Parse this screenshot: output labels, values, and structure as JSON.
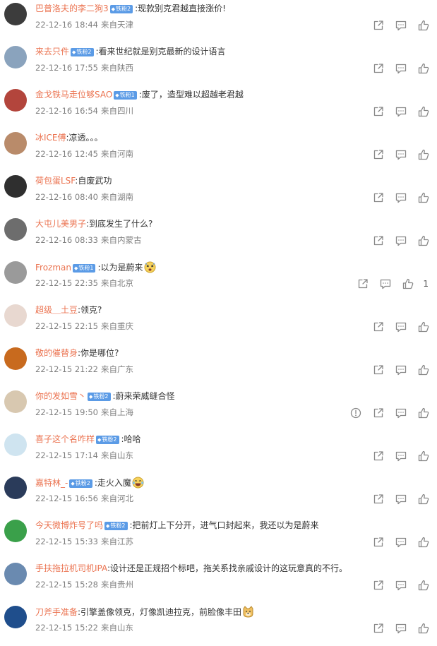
{
  "comments": [
    {
      "user": "巴普洛夫的李二狗3",
      "badge": "铁粉2",
      "text": ":现款别克君越直接涨价!",
      "time": "22-12-16 18:44",
      "location": "来自天津",
      "likes": "",
      "emoji": "",
      "report": false
    },
    {
      "user": "来去只件",
      "badge": "铁粉2",
      "text": ":看来世纪就是别克最新的设计语言",
      "time": "22-12-16 17:55",
      "location": "来自陕西",
      "likes": "",
      "emoji": "",
      "report": false
    },
    {
      "user": "金戈铁马走位够SAO",
      "badge": "铁粉1",
      "text": ":废了，造型难以超越老君越",
      "time": "22-12-16 16:54",
      "location": "来自四川",
      "likes": "",
      "emoji": "",
      "report": false
    },
    {
      "user": "冰ICE傅",
      "badge": "",
      "text": ":凉透。。。",
      "time": "22-12-16 12:45",
      "location": "来自河南",
      "likes": "",
      "emoji": "",
      "report": false
    },
    {
      "user": "荷包蛋LSF",
      "badge": "",
      "text": ":自废武功",
      "time": "22-12-16 08:40",
      "location": "来自湖南",
      "likes": "",
      "emoji": "",
      "report": false
    },
    {
      "user": "大屯儿美男子",
      "badge": "",
      "text": ":到底发生了什么?",
      "time": "22-12-16 08:33",
      "location": "来自内蒙古",
      "likes": "",
      "emoji": "",
      "report": false
    },
    {
      "user": "Frozman",
      "badge": "铁粉1",
      "text": ":以为是蔚来",
      "time": "22-12-15 22:35",
      "location": "来自北京",
      "likes": "1",
      "emoji": "dizzy-face-emoji",
      "report": false
    },
    {
      "user": "超级＿土豆",
      "badge": "",
      "text": ":领克?",
      "time": "22-12-15 22:15",
      "location": "来自重庆",
      "likes": "",
      "emoji": "",
      "report": false
    },
    {
      "user": "敬的催替身",
      "badge": "",
      "text": ":你是哪位?",
      "time": "22-12-15 21:22",
      "location": "来自广东",
      "likes": "",
      "emoji": "",
      "report": false
    },
    {
      "user": "你的发如雪丶",
      "badge": "铁粉2",
      "text": ":蔚来荣威缝合怪",
      "time": "22-12-15 19:50",
      "location": "来自上海",
      "likes": "",
      "emoji": "",
      "report": true
    },
    {
      "user": "喜子这个名咋样",
      "badge": "铁粉2",
      "text": ":哈哈",
      "time": "22-12-15 17:14",
      "location": "来自山东",
      "likes": "",
      "emoji": "",
      "report": false
    },
    {
      "user": "嘉特林_-",
      "badge": "铁粉2",
      "text": ":走火入魔",
      "time": "22-12-15 16:56",
      "location": "来自河北",
      "likes": "",
      "emoji": "laughing-tears-emoji",
      "report": false
    },
    {
      "user": "今天微博炸号了吗",
      "badge": "铁粉2",
      "text": ":把前灯上下分开，进气口封起来，我还以为是蔚来",
      "time": "22-12-15 15:33",
      "location": "来自江苏",
      "likes": "",
      "emoji": "",
      "report": false
    },
    {
      "user": "手扶拖拉机司机IPA",
      "badge": "",
      "text": ":设计还是正规招个标吧，拖关系找亲戚设计的这玩意真的不行。",
      "time": "22-12-15 15:28",
      "location": "来自贵州",
      "likes": "",
      "emoji": "",
      "report": false
    },
    {
      "user": "刀斧手准备",
      "badge": "",
      "text": ":引擎盖像领克，灯像凯迪拉克，前脸像丰田",
      "time": "22-12-15 15:22",
      "location": "来自山东",
      "likes": "",
      "emoji": "doge-emoji",
      "report": false
    }
  ],
  "avatar_colors": [
    "#3c3c3c",
    "#8aa3bd",
    "#b3453c",
    "#b98b6a",
    "#2f2f2f",
    "#6d6d6d",
    "#9a9a9a",
    "#e8d8d0",
    "#c86a1e",
    "#d8c8b0",
    "#cfe4f0",
    "#2a3b5a",
    "#3aa04a",
    "#6a8ab0",
    "#1f4e8c"
  ],
  "colors": {
    "username": "#eb7350",
    "badge": "#5b9be6",
    "meta": "#808080",
    "icon": "#888888"
  }
}
